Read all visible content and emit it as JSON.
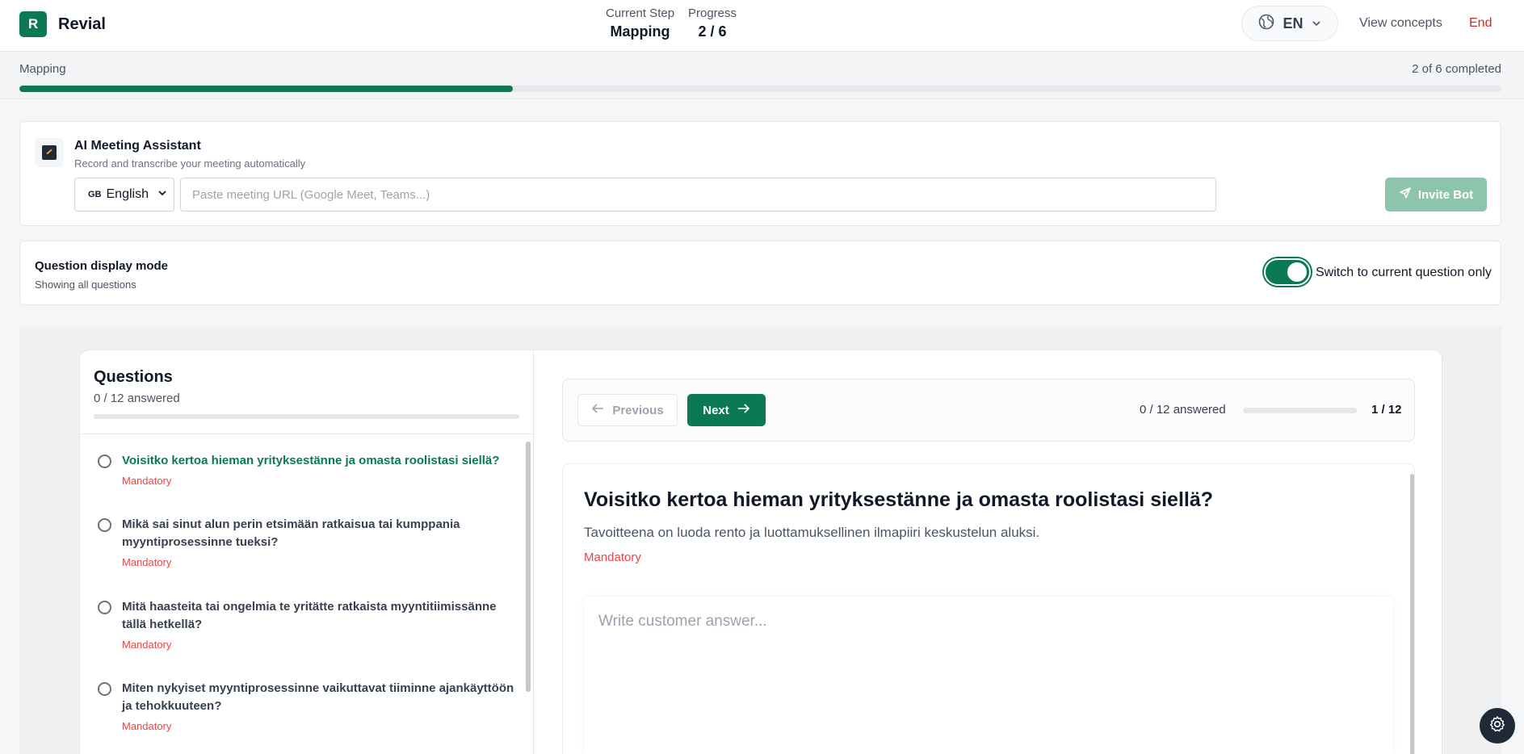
{
  "header": {
    "logo_letter": "R",
    "app_name": "Revial",
    "current_step_label": "Current Step",
    "current_step_value": "Mapping",
    "progress_label": "Progress",
    "progress_value": "2 / 6",
    "language": "EN",
    "view_concepts": "View concepts",
    "end": "End"
  },
  "progress_strip": {
    "label": "Mapping",
    "completed_text": "2 of 6 completed",
    "fraction": 0.333
  },
  "ai_assistant": {
    "title": "AI Meeting Assistant",
    "subtitle": "Record and transcribe your meeting automatically",
    "language_flag": "GB",
    "language": "English",
    "url_placeholder": "Paste meeting URL (Google Meet, Teams...)",
    "url_value": "",
    "invite_label": "Invite Bot"
  },
  "display_mode": {
    "title": "Question display mode",
    "subtitle": "Showing all questions",
    "toggle_label": "Switch to current question only",
    "toggle_on": true
  },
  "sidebar": {
    "title": "Questions",
    "answered": "0 / 12 answered",
    "progress_fraction": 0,
    "questions": [
      {
        "text": "Voisitko kertoa hieman yrityksestänne ja omasta roolistasi siellä?",
        "tag": "Mandatory",
        "active": true
      },
      {
        "text": "Mikä sai sinut alun perin etsimään ratkaisua tai kumppania myyntiprosessinne tueksi?",
        "tag": "Mandatory",
        "active": false
      },
      {
        "text": "Mitä haasteita tai ongelmia te yritätte ratkaista myyntitiimissänne tällä hetkellä?",
        "tag": "Mandatory",
        "active": false
      },
      {
        "text": "Miten nykyiset myyntiprosessinne vaikuttavat tiiminne ajankäyttöön ja tehokkuuteen?",
        "tag": "Mandatory",
        "active": false
      }
    ]
  },
  "navigation": {
    "previous": "Previous",
    "next": "Next",
    "answered": "0 / 12 answered",
    "progress_fraction": 0,
    "index": "1 / 12"
  },
  "current_question": {
    "title": "Voisitko kertoa hieman yrityksestänne ja omasta roolistasi siellä?",
    "description": "Tavoitteena on luoda rento ja luottamuksellinen ilmapiiri keskustelun aluksi.",
    "tag": "Mandatory",
    "answer_placeholder": "Write customer answer...",
    "answer_value": ""
  },
  "colors": {
    "brand": "#0b7a52",
    "danger": "#ef4444",
    "invite_disabled": "#8fc4ac"
  },
  "icons": {
    "language": "globe-icon",
    "settings": "gear-icon",
    "invite": "send-icon"
  }
}
